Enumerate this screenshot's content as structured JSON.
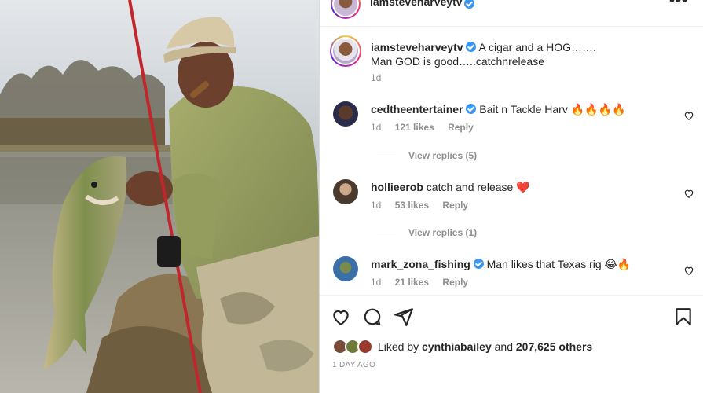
{
  "header": {
    "username": "iamsteveharveytv",
    "more_label": "•••"
  },
  "caption": {
    "username": "iamsteveharveytv",
    "text": "A cigar and a HOG…….",
    "text_line2": "Man GOD is good…..catchnrelease",
    "time": "1d"
  },
  "comments": [
    {
      "username": "cedtheentertainer",
      "verified": true,
      "text": "Bait n Tackle Harv 🔥🔥🔥🔥",
      "time": "1d",
      "likes": "121 likes",
      "reply": "Reply",
      "view_replies": "View replies (5)"
    },
    {
      "username": "hollieerob",
      "verified": false,
      "text": "catch and release ❤️",
      "time": "1d",
      "likes": "53 likes",
      "reply": "Reply",
      "view_replies": "View replies (1)"
    },
    {
      "username": "mark_zona_fishing",
      "verified": true,
      "text": "Man likes that Texas rig 😂🔥",
      "time": "1d",
      "likes": "21 likes",
      "reply": "Reply"
    }
  ],
  "likes": {
    "prefix": "Liked by",
    "user": "cynthiabailey",
    "conj": "and",
    "count": "207,625 others"
  },
  "timestamp": "1 DAY AGO",
  "colors": {
    "verified": "#3897f0",
    "muted": "#8e8e8e",
    "text": "#262626"
  },
  "icons": [
    "more-options-icon",
    "verified-badge-icon",
    "heart-icon",
    "comment-icon",
    "share-icon",
    "bookmark-icon"
  ]
}
